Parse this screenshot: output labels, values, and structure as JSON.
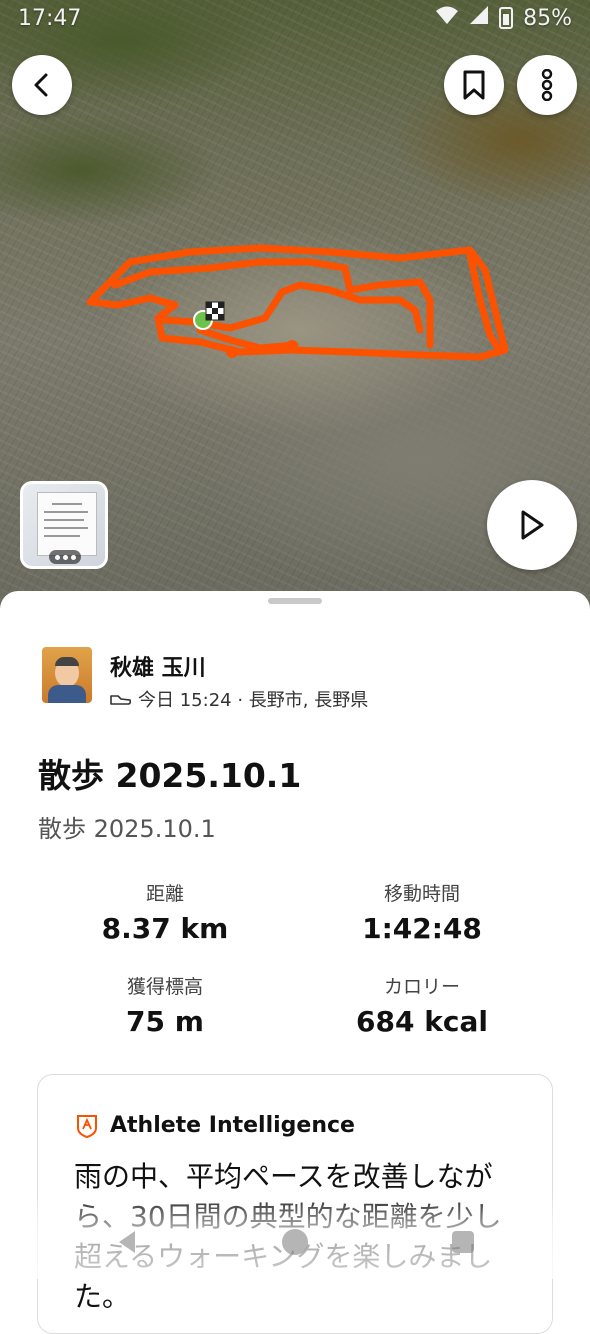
{
  "status_bar": {
    "time": "17:47",
    "battery": "85%"
  },
  "colors": {
    "route": "#fc5200",
    "start_marker": "#6cc24a"
  },
  "map": {
    "icons": {
      "back": "chevron-left-icon",
      "bookmark": "bookmark-icon",
      "more": "more-vertical-icon",
      "play": "play-icon"
    }
  },
  "activity": {
    "athlete_name": "秋雄 玉川",
    "meta": "今日 15:24 · 長野市, 長野県",
    "activity_icon": "shoe-icon",
    "title": "散歩 2025.10.1",
    "description": "散歩 2025.10.1",
    "stats": [
      {
        "label": "距離",
        "value": "8.37 km"
      },
      {
        "label": "移動時間",
        "value": "1:42:48"
      },
      {
        "label": "獲得標高",
        "value": "75 m"
      },
      {
        "label": "カロリー",
        "value": "684 kcal"
      }
    ]
  },
  "athlete_intelligence": {
    "title": "Athlete Intelligence",
    "text": "雨の中、平均ペースを改善しながら、30日間の典型的な距離を少し超えるウォーキングを楽しみました。"
  }
}
